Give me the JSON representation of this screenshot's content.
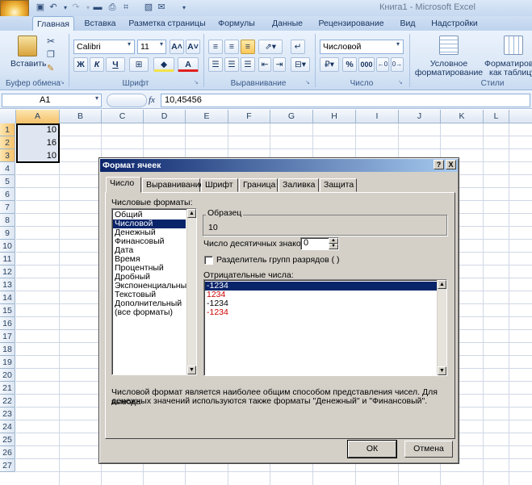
{
  "window": {
    "title": "Книга1 - Microsoft Excel"
  },
  "ribbon": {
    "tabs": [
      "Главная",
      "Вставка",
      "Разметка страницы",
      "Формулы",
      "Данные",
      "Рецензирование",
      "Вид",
      "Надстройки"
    ],
    "active_tab": "Главная",
    "paste_label": "Вставить",
    "clipboard_group": "Буфер обмена",
    "font_name": "Calibri",
    "font_size": "11",
    "bold": "Ж",
    "italic": "К",
    "underline": "Ч",
    "font_group": "Шрифт",
    "align_group": "Выравнивание",
    "number_format": "Числовой",
    "number_group": "Число",
    "percent": "%",
    "thousands": "000",
    "cond_format_1": "Условное",
    "cond_format_2": "форматирование",
    "format_table_1": "Форматировать",
    "format_table_2": "как таблицу",
    "styles_group": "Стили",
    "fx": "fx"
  },
  "formula_bar": {
    "cell_ref": "A1",
    "value": "10,45456"
  },
  "grid": {
    "columns": [
      "A",
      "B",
      "C",
      "D",
      "E",
      "F",
      "G",
      "H",
      "I",
      "J",
      "K",
      "L"
    ],
    "rows": [
      "1",
      "2",
      "3",
      "4",
      "5",
      "6",
      "7",
      "8",
      "9",
      "10",
      "11",
      "12",
      "13",
      "14",
      "15",
      "16",
      "17",
      "18",
      "19",
      "20",
      "21",
      "22",
      "23",
      "24",
      "25",
      "26",
      "27"
    ],
    "a_values": [
      "10",
      "16",
      "10"
    ]
  },
  "dialog": {
    "title": "Формат ячеек",
    "help_btn": "?",
    "close_btn": "X",
    "tabs": [
      "Число",
      "Выравнивание",
      "Шрифт",
      "Граница",
      "Заливка",
      "Защита"
    ],
    "formats_label": "Числовые форматы:",
    "formats": [
      "Общий",
      "Числовой",
      "Денежный",
      "Финансовый",
      "Дата",
      "Время",
      "Процентный",
      "Дробный",
      "Экспоненциальный",
      "Текстовый",
      "Дополнительный",
      "(все форматы)"
    ],
    "selected_format": "Числовой",
    "sample_label": "Образец",
    "sample_value": "10",
    "decimals_label": "Число десятичных знаков:",
    "decimals_value": "0",
    "separator_label": "Разделитель групп разрядов ( )",
    "negative_label": "Отрицательные числа:",
    "negatives": [
      "-1234",
      "1234",
      "-1234",
      "-1234"
    ],
    "negative_colors": [
      "#ffffff",
      "#cc0000",
      "#000000",
      "#cc0000"
    ],
    "description_1": "Числовой формат является наиболее общим способом представления чисел. Для вывода",
    "description_2": "денежных значений используются также форматы \"Денежный\" и \"Финансовый\".",
    "ok": "ОК",
    "cancel": "Отмена"
  }
}
